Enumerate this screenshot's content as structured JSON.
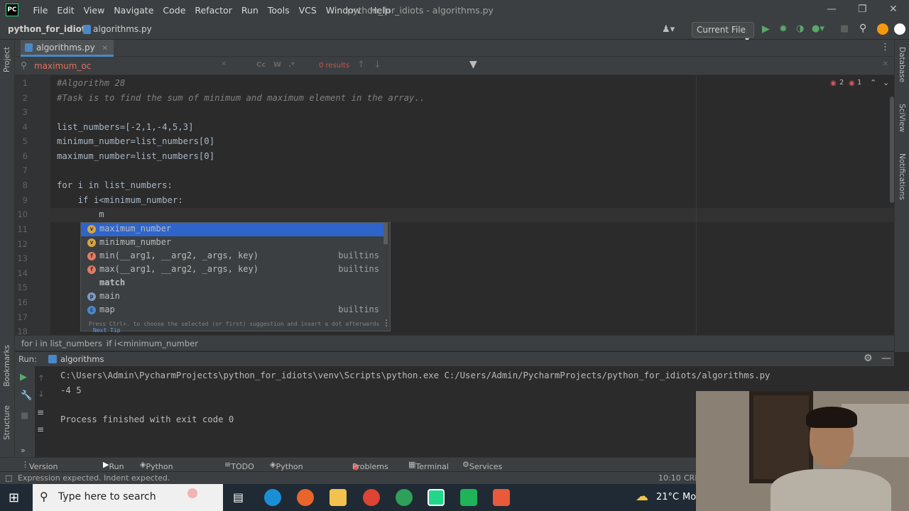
{
  "titlebar": {
    "logo": "PC",
    "menus": [
      "File",
      "Edit",
      "View",
      "Navigate",
      "Code",
      "Refactor",
      "Run",
      "Tools",
      "VCS",
      "Window",
      "Help"
    ],
    "window_title": "python_for_idiots - algorithms.py"
  },
  "navbar": {
    "project": "python_for_idiots",
    "file": "algorithms.py",
    "run_config": "Current File"
  },
  "left_strip": {
    "top": "Project",
    "bookmarks": "Bookmarks",
    "structure": "Structure"
  },
  "right_strip": {
    "database": "Database",
    "sciview": "SciView",
    "notifications": "Notifications"
  },
  "tabs": [
    {
      "label": "algorithms.py"
    }
  ],
  "search": {
    "query": "maximum_oc",
    "results": "0 results"
  },
  "editor": {
    "inspection": {
      "errors": "2",
      "warnings": "1"
    },
    "lines": [
      {
        "n": "1",
        "text": "#Algorithm 28"
      },
      {
        "n": "2",
        "text": "#Task is to find the sum of minimum and maximum element in the array.."
      },
      {
        "n": "3",
        "text": ""
      },
      {
        "n": "4",
        "text": "list_numbers=[-2,1,-4,5,3]"
      },
      {
        "n": "5",
        "text": "minimum_number=list_numbers[0]"
      },
      {
        "n": "6",
        "text": "maximum_number=list_numbers[0]"
      },
      {
        "n": "7",
        "text": ""
      },
      {
        "n": "8",
        "text": "for i in list_numbers:"
      },
      {
        "n": "9",
        "text": "    if i<minimum_number:"
      },
      {
        "n": "10",
        "text": "        m"
      },
      {
        "n": "11",
        "text": ""
      },
      {
        "n": "12",
        "text": ""
      },
      {
        "n": "13",
        "text": ""
      },
      {
        "n": "14",
        "text": ""
      },
      {
        "n": "15",
        "text": ""
      },
      {
        "n": "16",
        "text": ""
      },
      {
        "n": "17",
        "text": ""
      },
      {
        "n": "18",
        "text": ""
      }
    ]
  },
  "completion": {
    "items": [
      {
        "icon": "v",
        "name": "maximum_number",
        "source": ""
      },
      {
        "icon": "v",
        "name": "minimum_number",
        "source": ""
      },
      {
        "icon": "f",
        "name": "min(__arg1, __arg2, _args, key)",
        "source": "builtins"
      },
      {
        "icon": "f",
        "name": "max(__arg1, __arg2, _args, key)",
        "source": "builtins"
      },
      {
        "icon": "",
        "name": "match",
        "source": ""
      },
      {
        "icon": "p",
        "name": "main",
        "source": ""
      },
      {
        "icon": "c",
        "name": "map",
        "source": "builtins"
      }
    ],
    "footer": "Press Ctrl+. to choose the selected (or first) suggestion and insert a dot afterwards",
    "next_tip": "Next Tip"
  },
  "breadcrumb": [
    "for i in list_numbers",
    "if i<minimum_number"
  ],
  "run_panel": {
    "label": "Run:",
    "tab": "algorithms",
    "output": [
      "C:\\Users\\Admin\\PycharmProjects\\python_for_idiots\\venv\\Scripts\\python.exe C:/Users/Admin/PycharmProjects/python_for_idiots/algorithms.py",
      "-4 5",
      "",
      "Process finished with exit code 0"
    ]
  },
  "tool_windows": [
    "Version Control",
    "Run",
    "Python Packages",
    "TODO",
    "Python Console",
    "Problems",
    "Terminal",
    "Services"
  ],
  "status": {
    "message": "Expression expected. Indent expected.",
    "position": "10:10",
    "encoding": "CRL"
  },
  "taskbar": {
    "search_placeholder": "Type here to search",
    "temperature": "21°C",
    "weather_short": "Mo"
  }
}
